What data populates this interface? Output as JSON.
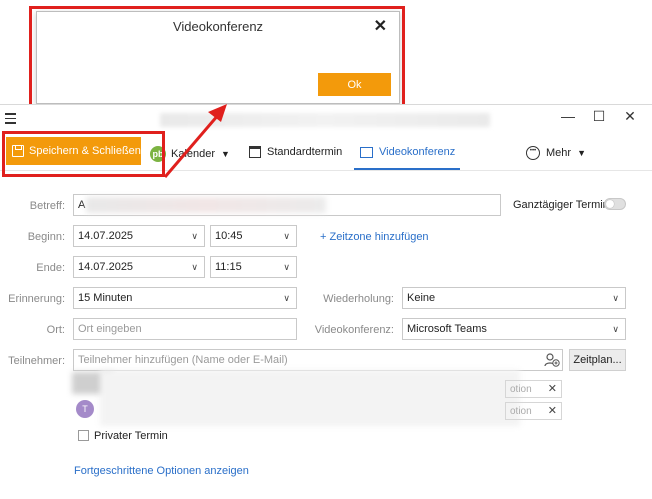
{
  "dialog": {
    "title": "Videokonferenz",
    "close_label": "✕",
    "ok_label": "Ok"
  },
  "window": {
    "minimize": "—",
    "maximize": "☐",
    "close": "✕"
  },
  "toolbar": {
    "save_label": "Speichern & Schließen",
    "calendar_logo": "pb",
    "calendar_label": "Kalender",
    "standard_label": "Standardtermin",
    "video_label": "Videokonferenz",
    "more_label": "Mehr",
    "accent_color": "#f39a0b",
    "tab_color": "#2a6fc9"
  },
  "form": {
    "subject_label": "Betreff:",
    "subject_value": "A",
    "allday_label": "Ganztägiger Termin",
    "begin_label": "Beginn:",
    "begin_date": "14.07.2025",
    "begin_time": "10:45",
    "timezone_link": "+ Zeitzone hinzufügen",
    "end_label": "Ende:",
    "end_date": "14.07.2025",
    "end_time": "11:15",
    "reminder_label": "Erinnerung:",
    "reminder_value": "15 Minuten",
    "repeat_label": "Wiederholung:",
    "repeat_value": "Keine",
    "location_label": "Ort:",
    "location_placeholder": "Ort eingeben",
    "videoconf_label": "Videokonferenz:",
    "videoconf_value": "Microsoft Teams",
    "participants_label": "Teilnehmer:",
    "participants_placeholder": "Teilnehmer hinzufügen (Name oder E-Mail)",
    "schedule_button": "Zeitplan...",
    "participant_avatar": "T",
    "chip1_text": "otion",
    "chip2_text": "otion",
    "private_label": "Privater Termin",
    "advanced_link": "Fortgeschrittene Optionen anzeigen"
  }
}
